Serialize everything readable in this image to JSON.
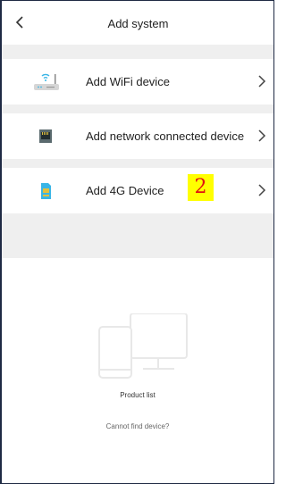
{
  "header": {
    "title": "Add system",
    "back_icon": "chevron-left-icon"
  },
  "devices": [
    {
      "label": "Add WiFi device",
      "icon": "router-icon"
    },
    {
      "label": "Add network connected device",
      "icon": "ethernet-port-icon"
    },
    {
      "label": "Add 4G Device",
      "icon": "sim-card-icon",
      "badge": "2"
    }
  ],
  "product": {
    "label": "Product list",
    "icon": "devices-icon"
  },
  "help": {
    "link": "Cannot find device?"
  },
  "colors": {
    "section_gap": "#efefef",
    "accent": "#39b5e6",
    "badge_bg": "#ffff00",
    "badge_text": "#e01010"
  }
}
